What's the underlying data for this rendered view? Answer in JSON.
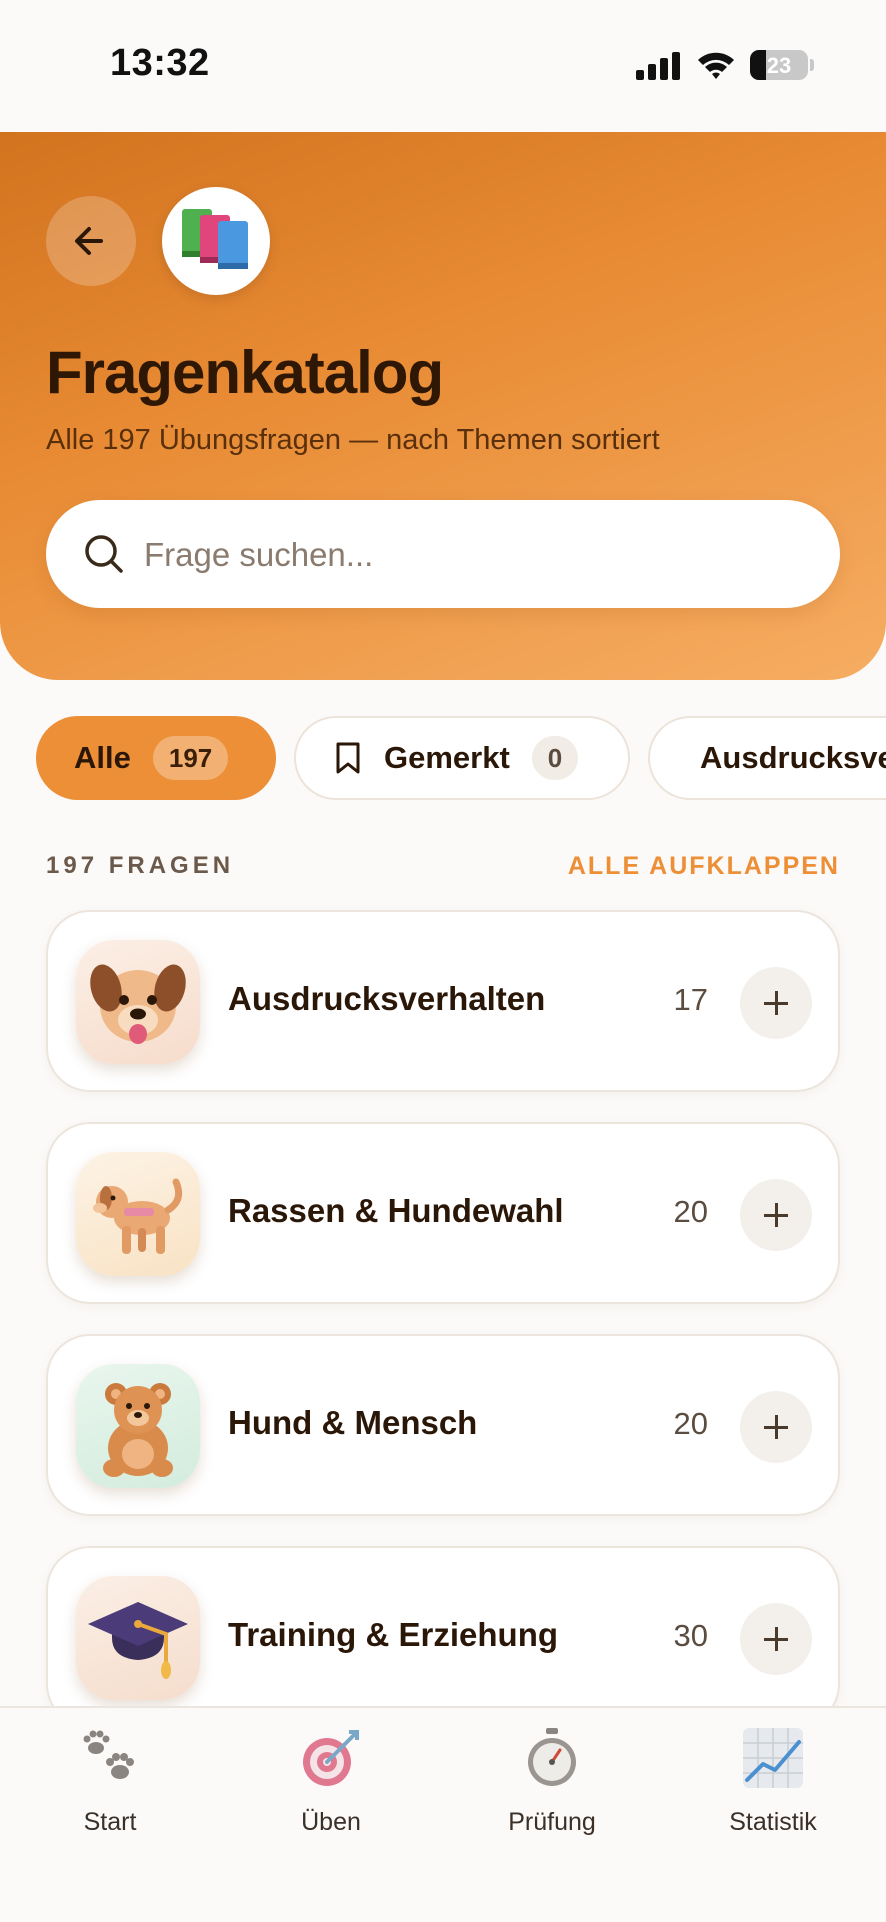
{
  "status_bar": {
    "time": "13:32",
    "battery": "23"
  },
  "header": {
    "title": "Fragenkatalog",
    "subtitle": "Alle 197 Übungsfragen — nach Themen sortiert",
    "search_placeholder": "Frage suchen..."
  },
  "filters": [
    {
      "label": "Alle",
      "count": "197",
      "active": true
    },
    {
      "label": "Gemerkt",
      "count": "0",
      "active": false
    },
    {
      "label": "Ausdrucksverhalten",
      "active": false
    }
  ],
  "section": {
    "label": "197 FRAGEN",
    "action": "ALLE AUFKLAPPEN"
  },
  "topics": [
    {
      "title": "Ausdrucksverhalten",
      "count": "17",
      "icon": "dog-face-icon"
    },
    {
      "title": "Rassen & Hundewahl",
      "count": "20",
      "icon": "dog-icon"
    },
    {
      "title": "Hund & Mensch",
      "count": "20",
      "icon": "teddy-bear-icon"
    },
    {
      "title": "Training & Erziehung",
      "count": "30",
      "icon": "graduation-cap-icon"
    }
  ],
  "bottom_nav": [
    {
      "label": "Start",
      "icon": "paw-prints-icon"
    },
    {
      "label": "Üben",
      "icon": "target-icon"
    },
    {
      "label": "Prüfung",
      "icon": "stopwatch-icon"
    },
    {
      "label": "Statistik",
      "icon": "chart-icon"
    }
  ],
  "colors": {
    "accent": "#ec8f37",
    "header_dark": "#d2731f",
    "header_light": "#f6ad62",
    "text": "#2a1708"
  }
}
